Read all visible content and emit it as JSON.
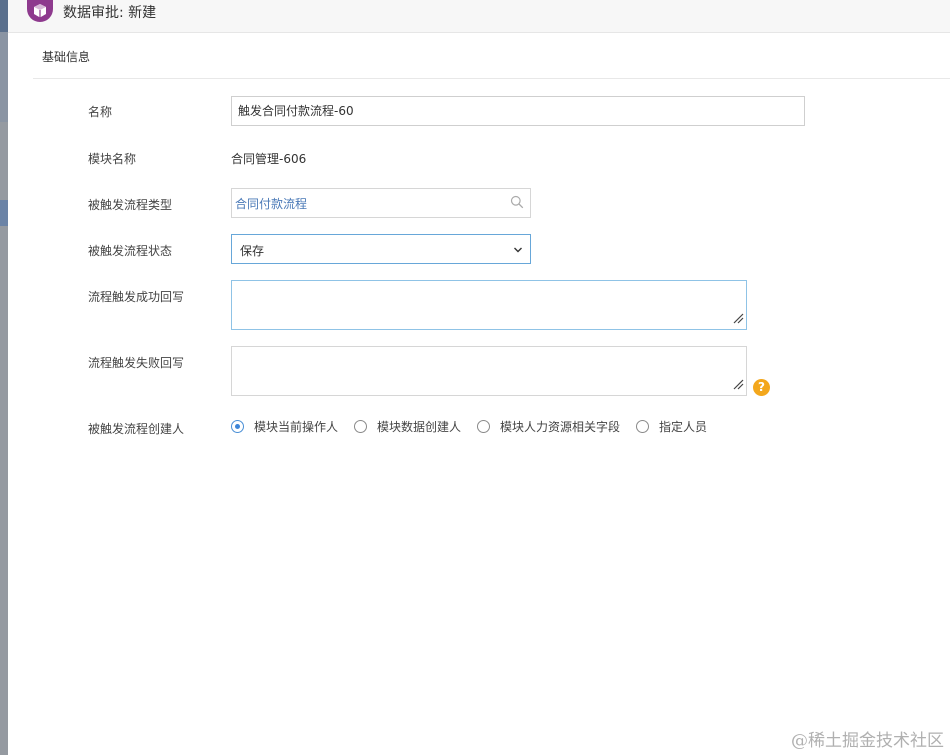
{
  "window": {
    "title": "数据审批: 新建"
  },
  "section": {
    "title": "基础信息"
  },
  "fields": {
    "name": {
      "label": "名称",
      "value": "触发合同付款流程-60"
    },
    "module_name": {
      "label": "模块名称",
      "value": "合同管理-606"
    },
    "flow_type": {
      "label": "被触发流程类型",
      "value": "合同付款流程",
      "icon": "search-icon"
    },
    "flow_status": {
      "label": "被触发流程状态",
      "value": "保存",
      "icon": "chevron-down-icon"
    },
    "success_writeback": {
      "label": "流程触发成功回写",
      "value": ""
    },
    "failure_writeback": {
      "label": "流程触发失败回写",
      "value": "",
      "help_icon": "?"
    },
    "creator": {
      "label": "被触发流程创建人",
      "options": [
        "模块当前操作人",
        "模块数据创建人",
        "模块人力资源相关字段",
        "指定人员"
      ],
      "selected": "模块当前操作人"
    }
  },
  "watermark": "@稀土掘金技术社区",
  "colors": {
    "accent": "#3d85d8",
    "logo": "#8e3a8e",
    "help": "#f3a71c",
    "link": "#4a79b7"
  }
}
